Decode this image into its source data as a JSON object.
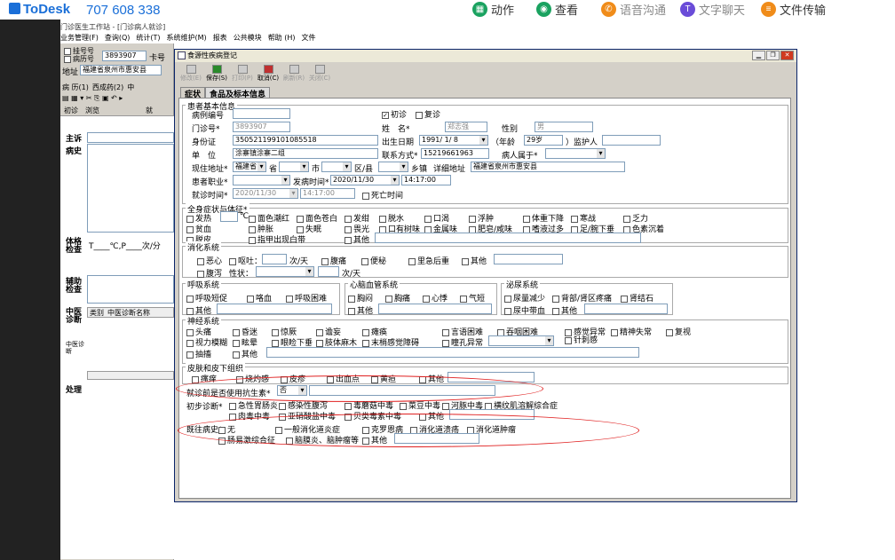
{
  "todesk": {
    "logo": "ToDesk",
    "id": "707 608 338",
    "actions": [
      "动作",
      "查看",
      "语音沟通",
      "文字聊天",
      "文件传输"
    ],
    "colors": [
      "#1aa260",
      "#1aa260",
      "#f08c1a",
      "#6a4cd8",
      "#f08c1a"
    ]
  },
  "bg": {
    "title": "门诊医生工作站 - [门诊病人就诊]",
    "menu": [
      "业务管理(F)",
      "查询(Q)",
      "统计(T)",
      "系统维护(M)",
      "报表",
      "公共模块",
      "帮助 (H)",
      "文件"
    ],
    "reg_label": "挂号号",
    "record_label": "病历号",
    "reg_value": "3893907",
    "card_label": "卡号",
    "addr_label": "地址",
    "addr_value": "福建省泉州市惠安县",
    "tabs": [
      "病 历(1)",
      "西成药(2)",
      "中"
    ],
    "sub_tabs": [
      "初诊",
      "浏览"
    ],
    "sub_tab_extra": "就",
    "sections": [
      "主诉",
      "病史",
      "体格检查",
      "辅助检查",
      "中医诊断",
      "中医诊断",
      "处理"
    ],
    "exam_line": "T____℃,P____次/分",
    "diag_cols": [
      "类别",
      "中医诊断名称"
    ]
  },
  "dialog": {
    "title": "食源性疾病登记",
    "toolbar": [
      "修改(E)",
      "保存(S)",
      "打印(P)",
      "取消(C)",
      "刷新(R)",
      "关闭(C)"
    ],
    "tabs": [
      "症状",
      "食品及标本信息"
    ],
    "basic": {
      "group": "患者基本信息",
      "case_no_label": "病例编号",
      "clinic_no_label": "门诊号*",
      "clinic_no": "3893907",
      "first_visit": "初诊",
      "revisit": "复诊",
      "name_label": "姓　名*",
      "name": "郑志强",
      "sex_label": "性别",
      "sex": "男",
      "id_label": "身份证",
      "id": "350521199101085518",
      "dob_label": "出生日期",
      "dob": "1991/ 1/ 8",
      "age_label": "（年龄",
      "age": "29岁",
      "guardian_label": "）监护人",
      "unit_label": "单　位",
      "unit": "涂寨镇涂寨二组",
      "phone_label": "联系方式*",
      "phone": "15219661963",
      "belong_label": "病人属于*",
      "addr_label": "现住地址*",
      "province": "福建省",
      "province_suffix": "省",
      "city_suffix": "市",
      "county_suffix": "区/县",
      "town_suffix": "乡镇",
      "detail_label": "详细地址",
      "detail": "福建省泉州市惠安县",
      "job_label": "患者职业*",
      "onset_label": "发病时间*",
      "onset_date": "2020/11/30",
      "onset_time": "14:17:00",
      "visit_label": "就诊时间*",
      "visit_date": "2020/11/30",
      "visit_time": "14:17:00",
      "death_label": "死亡时间"
    },
    "systemic": {
      "group": "全身症状与体征*",
      "row1": [
        "发热",
        "面色潮红",
        "面色苍白",
        "发绀",
        "脱水",
        "口渴",
        "浮肿",
        "体重下降",
        "寒战",
        "乏力"
      ],
      "fever_unit": "℃",
      "row2": [
        "贫血",
        "肿胀",
        "失眠",
        "畏光",
        "口有树味",
        "金属味",
        "肥皂/咸味",
        "嗜液过多",
        "足/腕下垂",
        "色素沉着"
      ],
      "row3": [
        "脱皮",
        "指甲出现白带",
        "其他"
      ]
    },
    "digest": {
      "group": "消化系统",
      "nausea": "恶心",
      "vomit": "呕吐：",
      "vomit_unit": "次/天",
      "pain": "腹痛",
      "constipation": "便秘",
      "tenesmus": "里急后重",
      "other": "其他",
      "diarrhea": "腹泻",
      "nature": "性状：",
      "diarrhea_unit": "次/天"
    },
    "resp": {
      "group": "呼吸系统",
      "items": [
        "呼吸短促",
        "咯血",
        "呼吸困难"
      ],
      "other": "其他"
    },
    "cardio": {
      "group": "心脑血管系统",
      "items": [
        "胸闷",
        "胸痛",
        "心悸",
        "气短"
      ],
      "other": "其他"
    },
    "uro": {
      "group": "泌尿系统",
      "items": [
        "尿量减少",
        "背部/肾区疼痛",
        "肾结石"
      ],
      "items2": [
        "尿中带血",
        "其他"
      ]
    },
    "neuro": {
      "group": "神经系统",
      "row1": [
        "头痛",
        "昏迷",
        "惊厥",
        "谵妄",
        "瘫痪",
        "言语困难",
        "吞咽困难",
        "感觉异常",
        "精神失常",
        "复视"
      ],
      "row2": [
        "视力模糊",
        "眩晕",
        "眼睑下垂",
        "肢体麻木",
        "末梢感觉障碍",
        "瞳孔异常",
        "针刺感"
      ],
      "row3": [
        "抽搐",
        "其他"
      ]
    },
    "skin": {
      "group": "皮肤和皮下组织",
      "items": [
        "瘙痒",
        "烧灼感",
        "皮疹",
        "出血点",
        "黄疸",
        "其他"
      ]
    },
    "antibiotic": {
      "label": "就诊前是否使用抗生素*",
      "value": "否"
    },
    "diagnosis": {
      "label": "初步诊断*",
      "row1": [
        "急性胃肠炎",
        "感染性腹泻",
        "毒蘑菇中毒",
        "菜豆中毒",
        "河豚中毒",
        "横纹肌溶解综合症"
      ],
      "row2": [
        "肉毒中毒",
        "亚硝酸盐中毒",
        "贝类毒素中毒",
        "其他"
      ]
    },
    "history": {
      "label": "既往病史*",
      "row1": [
        "无",
        "一般消化道炎症",
        "克罗恩病",
        "消化道溃疡",
        "消化道肿瘤"
      ],
      "row2": [
        "肠易激综合征",
        "脑膜炎、脑肿瘤等",
        "其他"
      ]
    }
  }
}
